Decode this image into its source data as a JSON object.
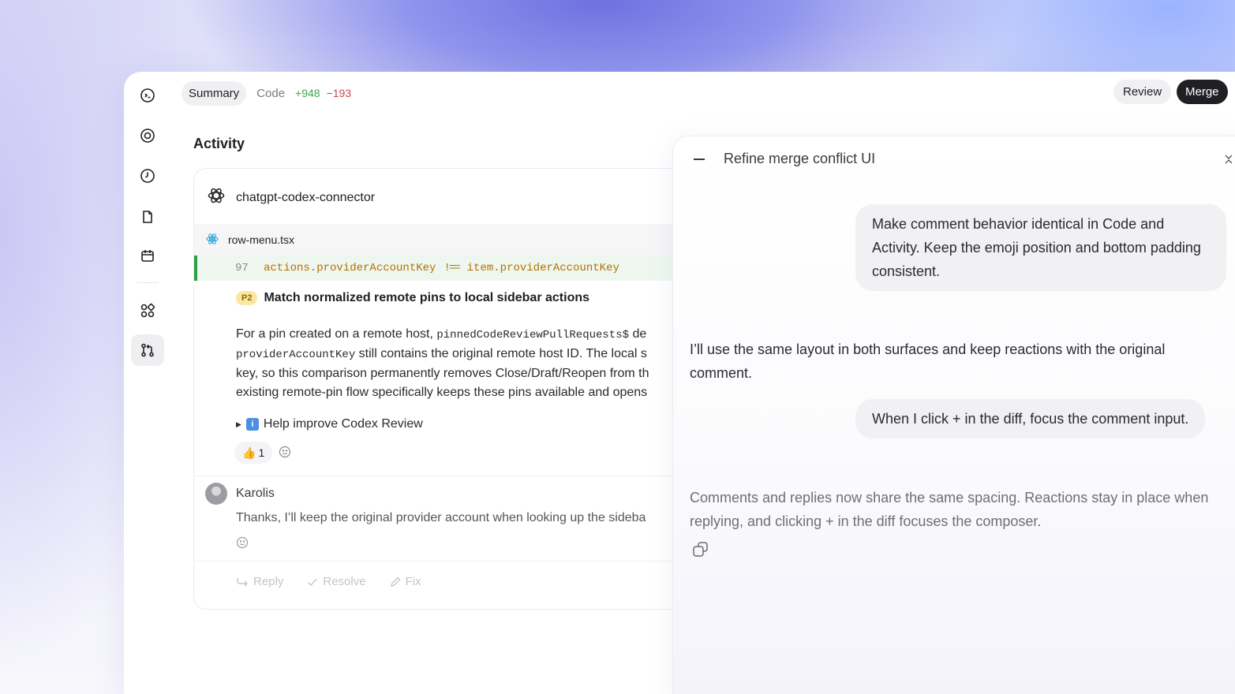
{
  "topbar": {
    "summary_tab": "Summary",
    "code_tab": "Code",
    "additions": "+948",
    "deletions": "−193",
    "review_button": "Review",
    "merge_button": "Merge"
  },
  "sidebar": {
    "icons": [
      "terminal-icon",
      "target-icon",
      "clock-icon",
      "document-icon",
      "calendar-icon",
      "apps-icon",
      "pull-request-icon"
    ],
    "active": "pull-request-icon"
  },
  "activity": {
    "title": "Activity",
    "bot_name": "chatgpt-codex-connector",
    "file_name": "row-menu.tsx",
    "code_line_number": "97",
    "code_left": "actions.providerAccountKey",
    "code_operator": "!==",
    "code_right": "item.providerAccountKey",
    "issue_priority": "P2",
    "issue_title": "Match normalized remote pins to local sidebar actions",
    "body_line1_a": "For a pin created on a remote host, ",
    "body_line1_code": "pinnedCodeReviewPullRequests$",
    "body_line1_b": " de",
    "body_line2_code": "providerAccountKey",
    "body_line2_b": " still contains the original remote host ID. The local s",
    "body_line3": "key, so this comparison permanently removes Close/Draft/Reopen from th",
    "body_line4": "existing remote-pin flow specifically keeps these pins available and opens",
    "details_label": "Help improve Codex Review",
    "reaction_emoji": "👍",
    "reaction_count": "1",
    "comment_author": "Karolis",
    "comment_text": "Thanks, I’ll keep the original provider account when looking up the sideba",
    "reply_label": "Reply",
    "resolve_label": "Resolve",
    "fix_label": "Fix"
  },
  "chat": {
    "title": "Refine merge conflict UI",
    "user_message_1": "Make comment behavior identical in Code and Activity. Keep the emoji position and bottom padding consistent.",
    "assistant_message_1": "I’ll use the same layout in both surfaces and keep reactions with the original comment.",
    "user_message_2": "When I click + in the diff, focus the comment input.",
    "assistant_message_2": "Comments and replies now share the same spacing. Reactions stay in place when replying, and clicking + in the diff focuses the composer."
  }
}
